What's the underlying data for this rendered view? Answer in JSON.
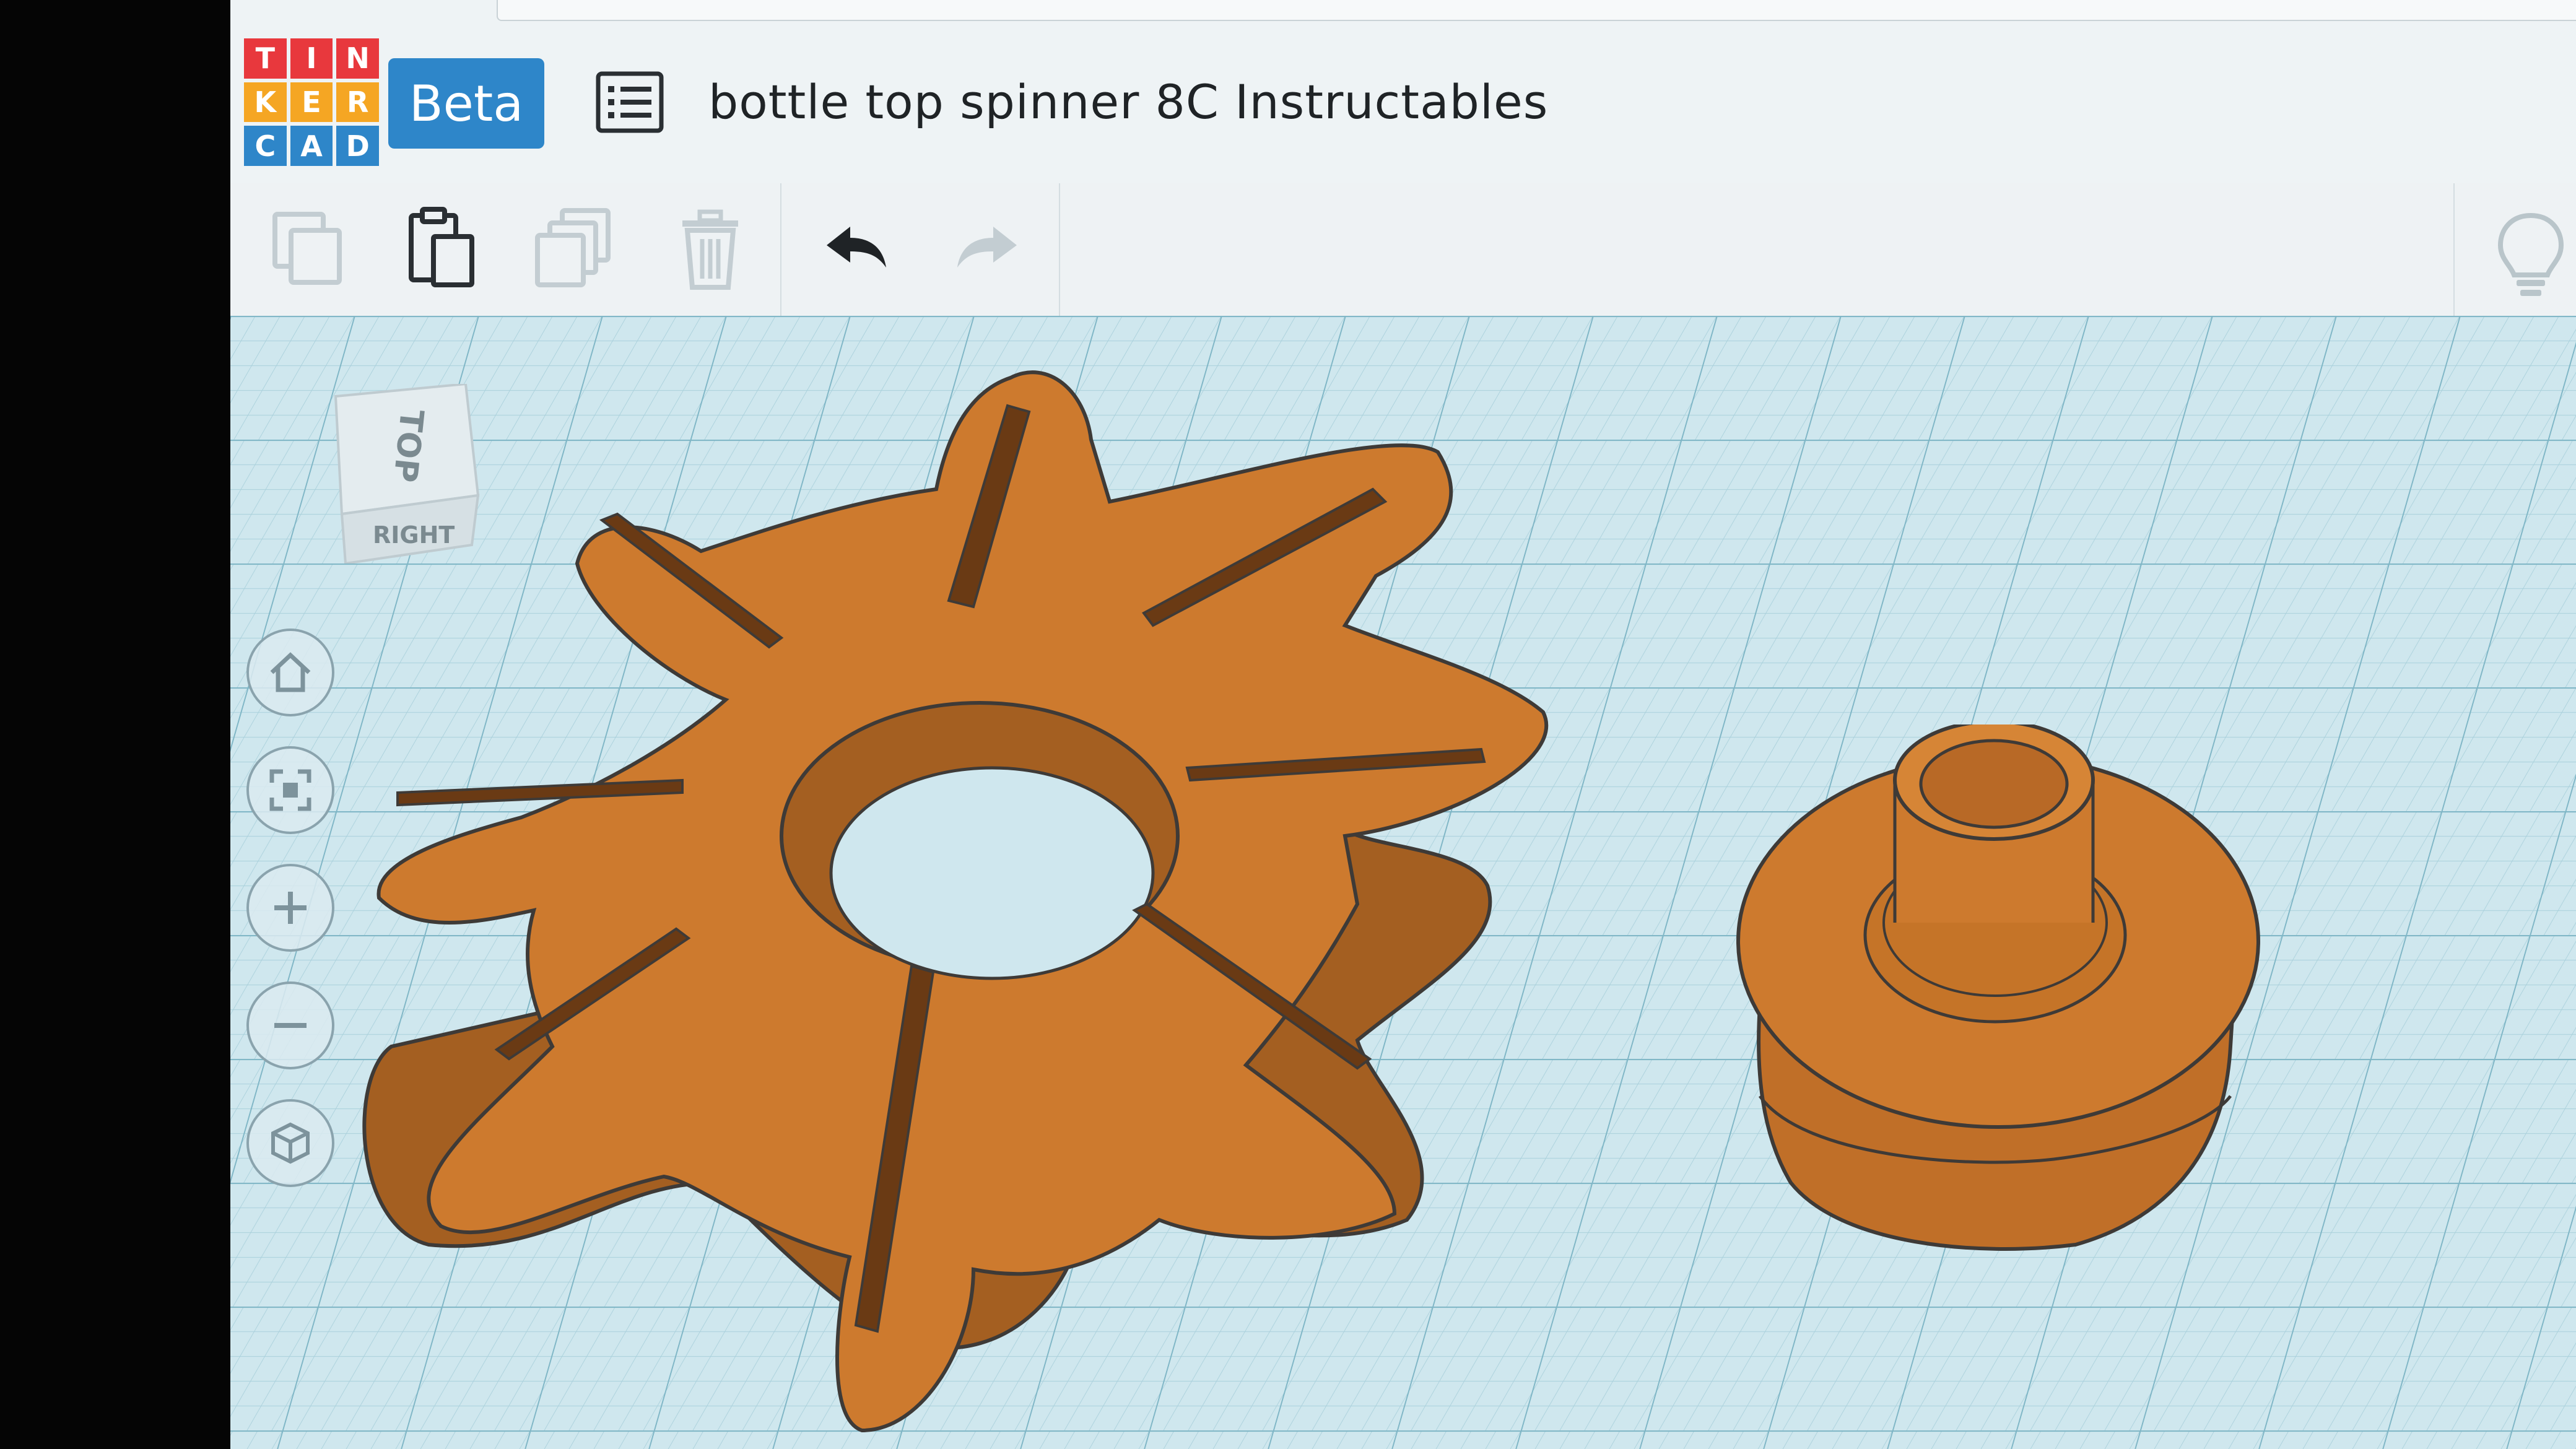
{
  "header": {
    "logo_letters": [
      "T",
      "I",
      "N",
      "K",
      "E",
      "R",
      "C",
      "A",
      "D"
    ],
    "logo_colors": [
      "#e8383d",
      "#e8383d",
      "#e8383d",
      "#f5a623",
      "#f5a623",
      "#f5a623",
      "#2e86c9",
      "#2e86c9",
      "#2e86c9"
    ],
    "beta_label": "Beta",
    "design_title": "bottle top spinner 8C Instructables"
  },
  "toolbar": {
    "buttons": [
      {
        "icon": "copy-icon",
        "enabled": false
      },
      {
        "icon": "paste-icon",
        "enabled": true
      },
      {
        "icon": "duplicate-icon",
        "enabled": false
      },
      {
        "icon": "trash-icon",
        "enabled": false
      },
      {
        "icon": "undo-icon",
        "enabled": true
      },
      {
        "icon": "redo-icon",
        "enabled": false
      }
    ]
  },
  "view_cube": {
    "top_label": "TOP",
    "right_label": "RIGHT"
  },
  "view_controls": [
    "home-icon",
    "fit-icon",
    "zoom-in-icon",
    "zoom-out-icon",
    "perspective-icon"
  ],
  "colors": {
    "shape_orange": "#cd7a2e",
    "shape_shadow": "#9e5a1e",
    "grid_line": "#9cc9d6",
    "workplane": "#cfe7ee",
    "beta_blue": "#2e86c9"
  }
}
